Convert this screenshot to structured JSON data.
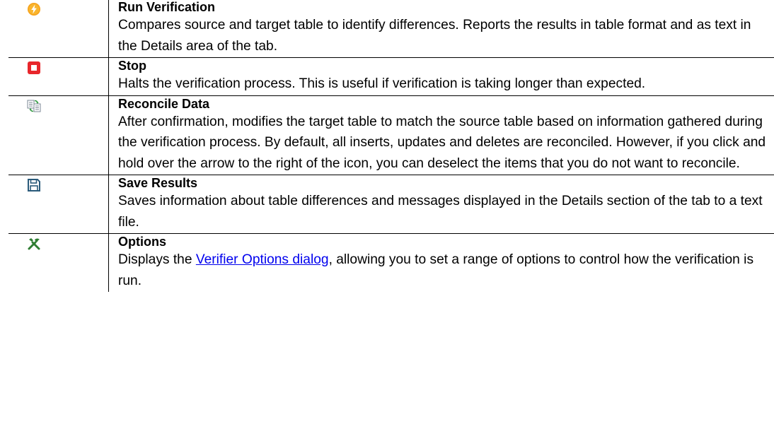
{
  "rows": [
    {
      "icon": "lightning-bolt-icon",
      "title": "Run Verification",
      "description": " Compares source and target table to identify differences. Reports the results in table format and as text in the Details area of the tab."
    },
    {
      "icon": "stop-icon",
      "title": "Stop",
      "description": " Halts the verification process. This is useful if verification is taking longer than expected."
    },
    {
      "icon": "reconcile-data-icon",
      "title": "Reconcile Data",
      "description": " After confirmation, modifies the target table to match the source table based on information gathered during the verification process. By default, all inserts, updates and deletes are reconciled. However, if you click and hold over the arrow to the right of the icon, you can deselect the items that you do not want to reconcile."
    },
    {
      "icon": "save-icon",
      "title": "Save Results",
      "description": " Saves information about table differences and messages displayed in the Details section of the tab to a text file."
    },
    {
      "icon": "tools-icon",
      "title": "Options",
      "description_before": " Displays the ",
      "link_text": "Verifier Options dialog",
      "description_after": ", allowing you to set a range of options to control how the verification is run."
    }
  ]
}
